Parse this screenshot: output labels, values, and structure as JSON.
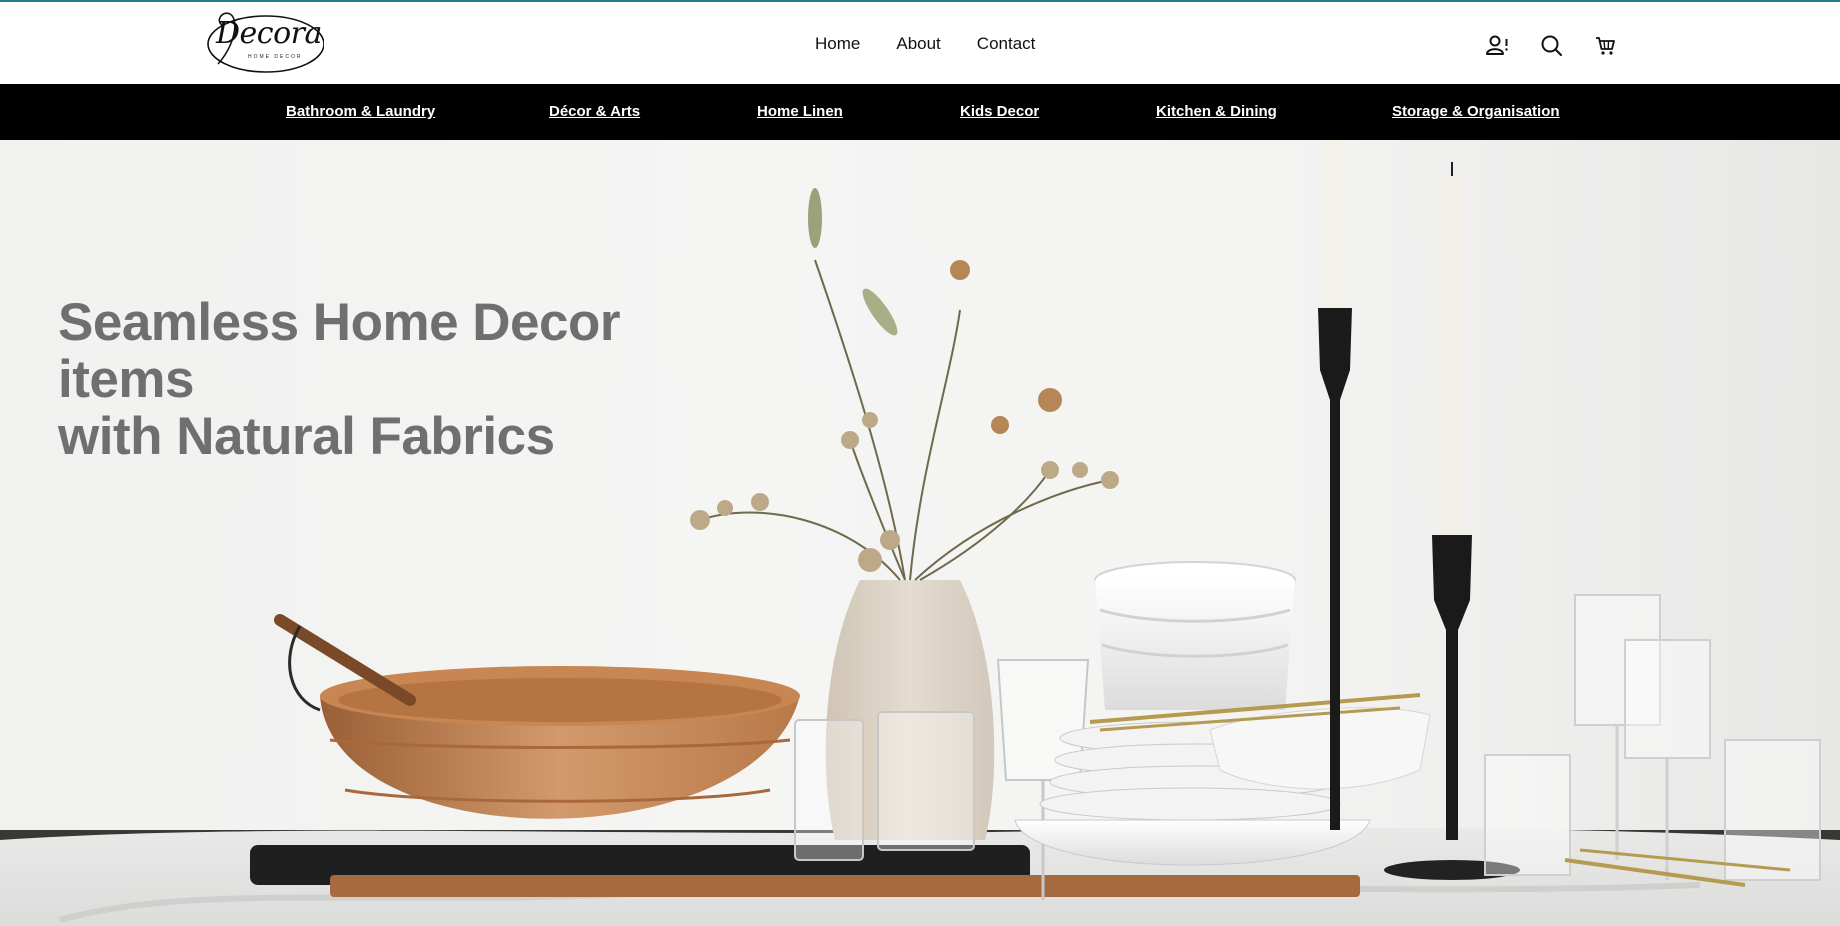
{
  "brand": {
    "name": "Decora",
    "tagline": "HOME DECOR"
  },
  "topnav": {
    "items": [
      "Home",
      "About",
      "Contact"
    ]
  },
  "header_icons": [
    "user-icon",
    "search-icon",
    "cart-icon"
  ],
  "categories": [
    "Bathroom & Laundry",
    "Décor & Arts",
    "Home Linen",
    "Kids Decor",
    "Kitchen & Dining",
    "Storage & Organisation"
  ],
  "hero": {
    "headline_line1": "Seamless Home Decor items",
    "headline_line2": "with Natural Fabrics"
  },
  "colors": {
    "accent_topline": "#1f7f86",
    "category_bar": "#000000",
    "headline_text": "#6f6f6f"
  }
}
